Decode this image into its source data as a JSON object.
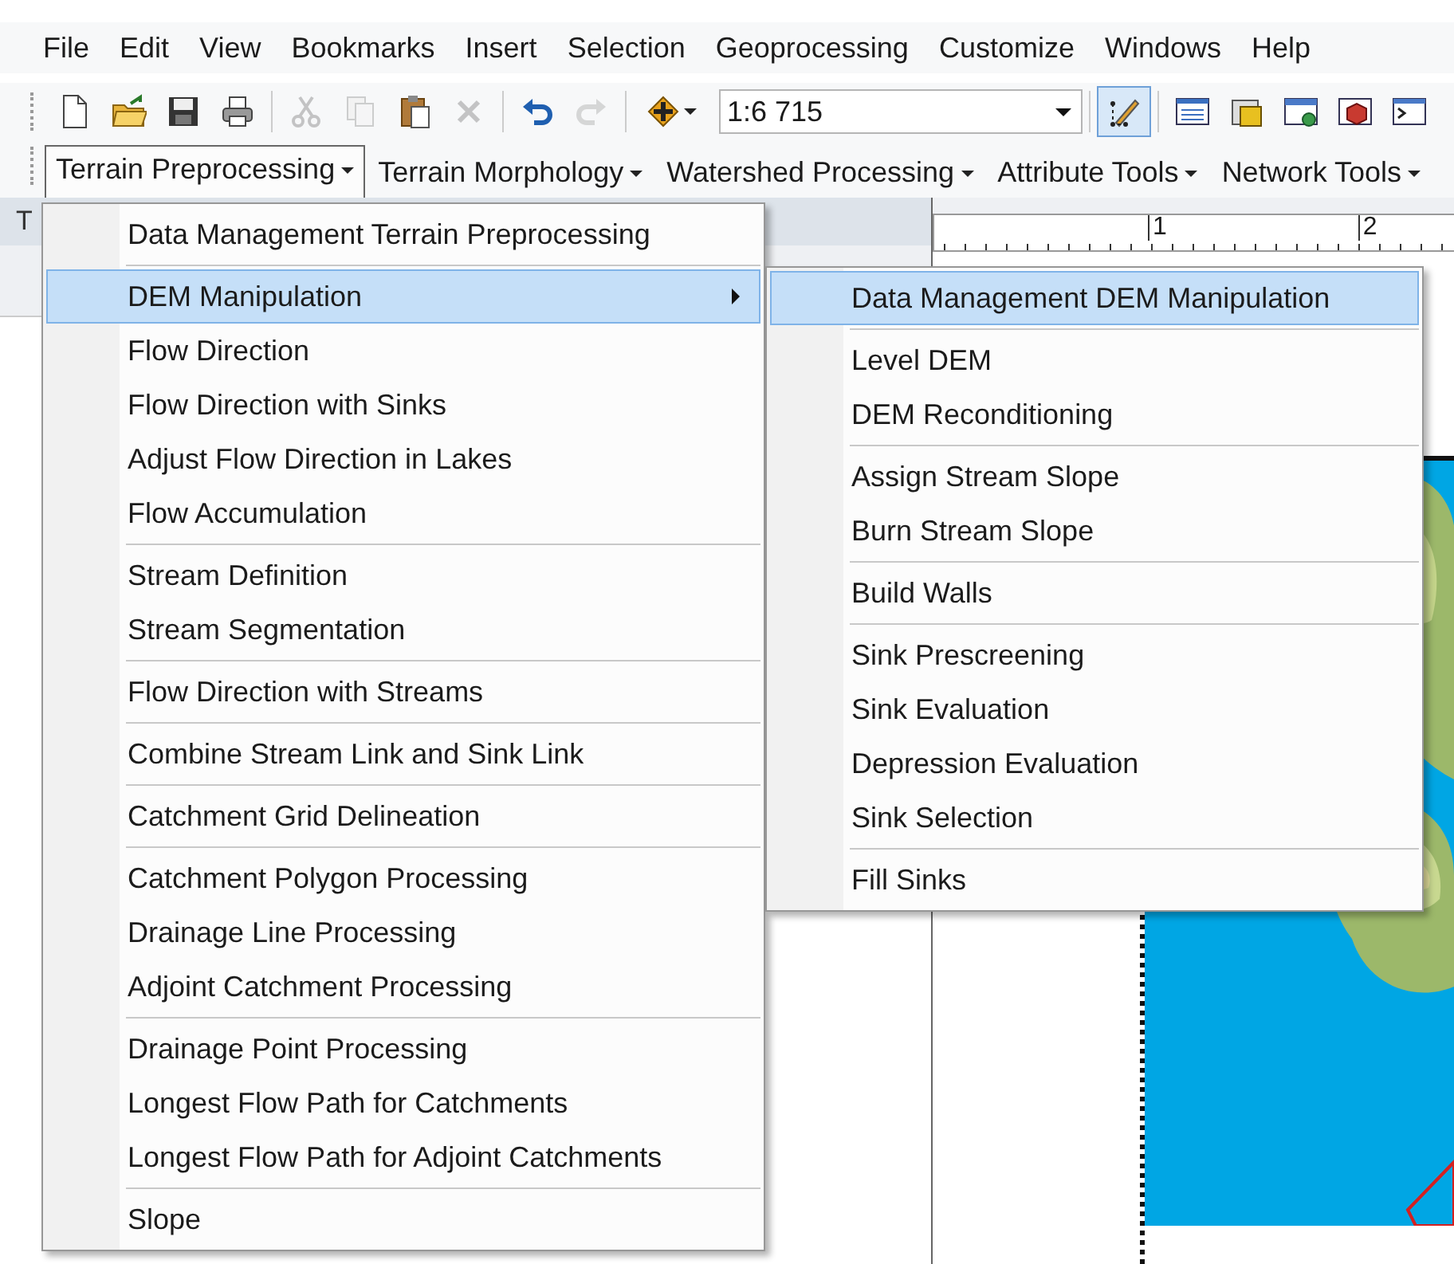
{
  "menu_bar": [
    "File",
    "Edit",
    "View",
    "Bookmarks",
    "Insert",
    "Selection",
    "Geoprocessing",
    "Customize",
    "Windows",
    "Help"
  ],
  "standard_toolbar": {
    "tools": [
      {
        "kind": "new",
        "disabled": false
      },
      {
        "kind": "open",
        "disabled": false
      },
      {
        "kind": "save",
        "disabled": false
      },
      {
        "kind": "print",
        "disabled": false
      },
      {
        "kind": "sep"
      },
      {
        "kind": "cut",
        "disabled": true
      },
      {
        "kind": "copy",
        "disabled": true
      },
      {
        "kind": "paste",
        "disabled": false
      },
      {
        "kind": "delete",
        "disabled": true
      },
      {
        "kind": "sep"
      },
      {
        "kind": "undo",
        "disabled": false
      },
      {
        "kind": "redo",
        "disabled": true
      },
      {
        "kind": "sep"
      },
      {
        "kind": "add",
        "disabled": false
      },
      {
        "kind": "scale"
      },
      {
        "kind": "sep"
      },
      {
        "kind": "edit",
        "disabled": false,
        "selected": true
      },
      {
        "kind": "sep"
      },
      {
        "kind": "list",
        "disabled": false
      },
      {
        "kind": "toolbox",
        "disabled": false
      },
      {
        "kind": "window",
        "disabled": false
      },
      {
        "kind": "cube",
        "disabled": false
      },
      {
        "kind": "terminal",
        "disabled": false
      }
    ],
    "scale": {
      "value": "1:6 715"
    }
  },
  "hydro_toolbar": [
    {
      "label": "Terrain Preprocessing",
      "selected": true
    },
    {
      "label": "Terrain Morphology",
      "selected": false
    },
    {
      "label": "Watershed Processing",
      "selected": false
    },
    {
      "label": "Attribute Tools",
      "selected": false
    },
    {
      "label": "Network Tools",
      "selected": false
    }
  ],
  "toc_panel": {
    "title": "T"
  },
  "ruler": {
    "labels": [
      "1",
      "2"
    ]
  },
  "main_menu": {
    "groups": [
      {
        "items": [
          {
            "label": "Data Management Terrain Preprocessing",
            "selected": false,
            "submenu": false
          }
        ]
      },
      {
        "items": [
          {
            "label": "DEM Manipulation",
            "selected": true,
            "submenu": true
          },
          {
            "label": "Flow Direction",
            "selected": false,
            "submenu": false
          },
          {
            "label": "Flow Direction with Sinks",
            "selected": false,
            "submenu": false
          },
          {
            "label": "Adjust Flow Direction in Lakes",
            "selected": false,
            "submenu": false
          },
          {
            "label": "Flow Accumulation",
            "selected": false,
            "submenu": false
          }
        ]
      },
      {
        "items": [
          {
            "label": "Stream Definition",
            "selected": false,
            "submenu": false
          },
          {
            "label": "Stream Segmentation",
            "selected": false,
            "submenu": false
          }
        ]
      },
      {
        "items": [
          {
            "label": "Flow Direction with Streams",
            "selected": false,
            "submenu": false
          }
        ]
      },
      {
        "items": [
          {
            "label": "Combine Stream Link and Sink Link",
            "selected": false,
            "submenu": false
          }
        ]
      },
      {
        "items": [
          {
            "label": "Catchment Grid Delineation",
            "selected": false,
            "submenu": false
          }
        ]
      },
      {
        "items": [
          {
            "label": "Catchment Polygon Processing",
            "selected": false,
            "submenu": false
          },
          {
            "label": "Drainage Line Processing",
            "selected": false,
            "submenu": false
          },
          {
            "label": "Adjoint Catchment Processing",
            "selected": false,
            "submenu": false
          }
        ]
      },
      {
        "items": [
          {
            "label": "Drainage Point Processing",
            "selected": false,
            "submenu": false
          },
          {
            "label": "Longest Flow Path for Catchments",
            "selected": false,
            "submenu": false
          },
          {
            "label": "Longest Flow Path for Adjoint Catchments",
            "selected": false,
            "submenu": false
          }
        ]
      },
      {
        "items": [
          {
            "label": "Slope",
            "selected": false,
            "submenu": false
          }
        ]
      }
    ]
  },
  "sub_menu": {
    "groups": [
      {
        "items": [
          {
            "label": "Data Management DEM Manipulation",
            "selected": true,
            "submenu": false
          }
        ]
      },
      {
        "items": [
          {
            "label": "Level DEM",
            "selected": false,
            "submenu": false
          },
          {
            "label": "DEM Reconditioning",
            "selected": false,
            "submenu": false
          }
        ]
      },
      {
        "items": [
          {
            "label": "Assign Stream Slope",
            "selected": false,
            "submenu": false
          },
          {
            "label": "Burn Stream Slope",
            "selected": false,
            "submenu": false
          }
        ]
      },
      {
        "items": [
          {
            "label": "Build Walls",
            "selected": false,
            "submenu": false
          }
        ]
      },
      {
        "items": [
          {
            "label": "Sink Prescreening",
            "selected": false,
            "submenu": false
          },
          {
            "label": "Sink Evaluation",
            "selected": false,
            "submenu": false
          },
          {
            "label": "Depression Evaluation",
            "selected": false,
            "submenu": false
          },
          {
            "label": "Sink Selection",
            "selected": false,
            "submenu": false
          }
        ]
      },
      {
        "items": [
          {
            "label": "Fill Sinks",
            "selected": false,
            "submenu": false
          }
        ]
      }
    ]
  }
}
